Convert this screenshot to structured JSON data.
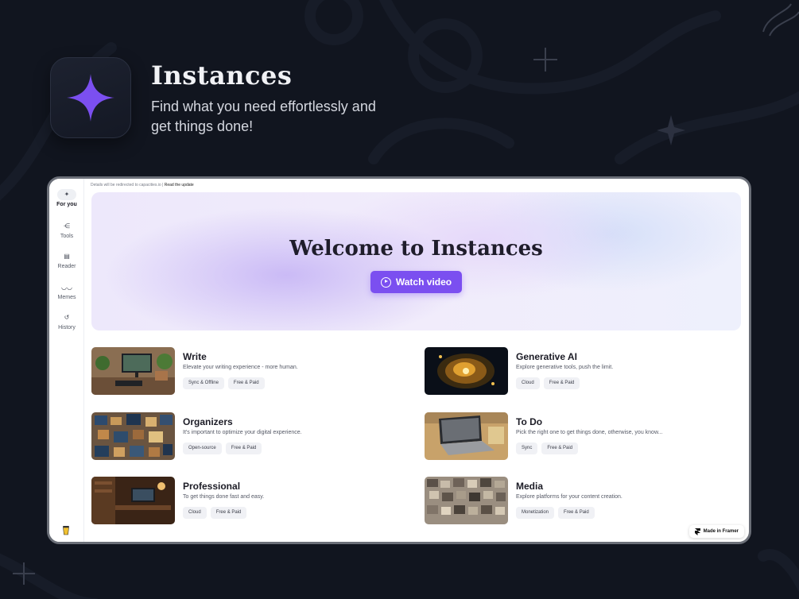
{
  "brand": {
    "title": "Instances",
    "subtitle": "Find what you need effortlessly and get things done!",
    "accent": "#7b4ff0"
  },
  "app": {
    "notice_text": "Details will be redirected to capacities.io",
    "notice_link": "Read the update",
    "sidebar": [
      {
        "label": "For you",
        "icon": "sparkle-icon",
        "active": true
      },
      {
        "label": "Tools",
        "icon": "share-nodes-icon",
        "active": false
      },
      {
        "label": "Reader",
        "icon": "book-icon",
        "active": false
      },
      {
        "label": "Memes",
        "icon": "glasses-icon",
        "active": false
      },
      {
        "label": "History",
        "icon": "history-icon",
        "active": false
      }
    ],
    "banner": {
      "title": "Welcome to Instances",
      "button_label": "Watch video"
    },
    "cards": [
      {
        "title": "Write",
        "description": "Elevate your writing experience - more human.",
        "tags": [
          "Sync & Offline",
          "Free & Paid"
        ]
      },
      {
        "title": "Generative AI",
        "description": "Explore generative tools, push the limit.",
        "tags": [
          "Cloud",
          "Free & Paid"
        ]
      },
      {
        "title": "Organizers",
        "description": "It's important to optimize your digital experience.",
        "tags": [
          "Open-source",
          "Free & Paid"
        ]
      },
      {
        "title": "To Do",
        "description": "Pick the right one to get things done, otherwise, you know...",
        "tags": [
          "Sync",
          "Free & Paid"
        ]
      },
      {
        "title": "Professional",
        "description": "To get things done fast and easy.",
        "tags": [
          "Cloud",
          "Free & Paid"
        ]
      },
      {
        "title": "Media",
        "description": "Explore platforms for your content creation.",
        "tags": [
          "Monetization",
          "Free & Paid"
        ]
      }
    ],
    "framer_badge": "Made in Framer"
  }
}
